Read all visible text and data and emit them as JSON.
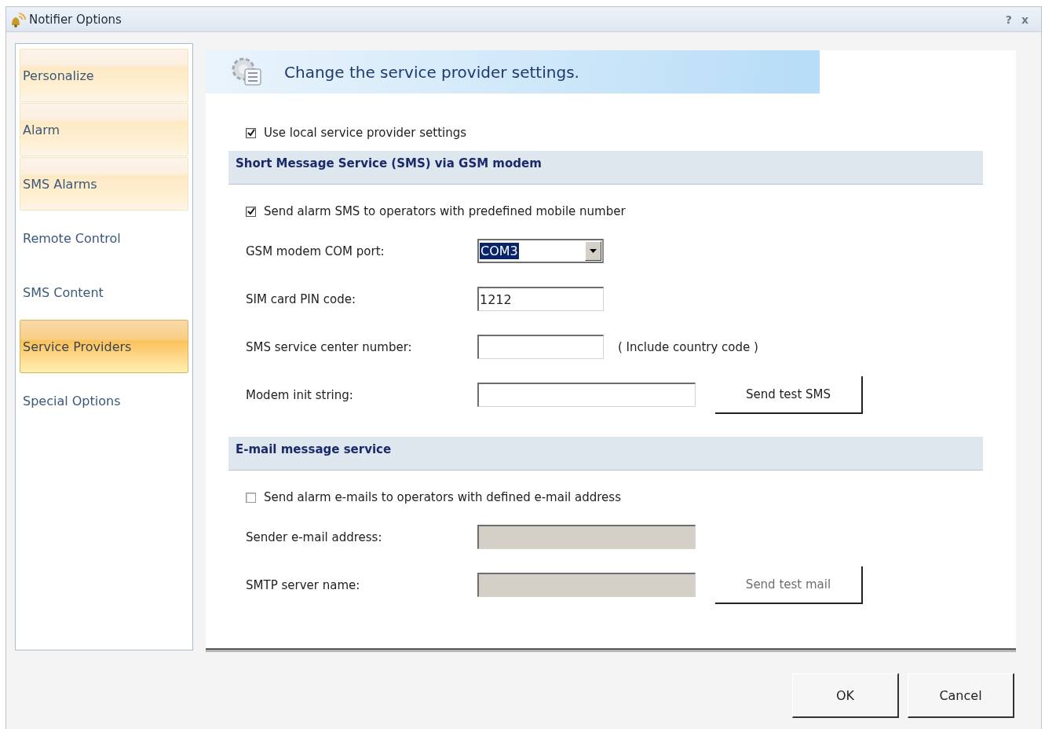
{
  "window": {
    "title": "Notifier Options",
    "controls": [
      "?",
      "x"
    ]
  },
  "sidebar": {
    "items": [
      {
        "label": "Personalize",
        "selected": false,
        "highlighted": true
      },
      {
        "label": "Alarm",
        "selected": false,
        "highlighted": true
      },
      {
        "label": "SMS Alarms",
        "selected": false,
        "highlighted": true
      },
      {
        "label": "Remote Control",
        "selected": false,
        "highlighted": false
      },
      {
        "label": "SMS Content",
        "selected": false,
        "highlighted": false
      },
      {
        "label": "Service Providers",
        "selected": true,
        "highlighted": false
      },
      {
        "label": "Special Options",
        "selected": false,
        "highlighted": false
      }
    ]
  },
  "header": {
    "title": "Change the service provider settings."
  },
  "use_local": {
    "label": "Use local service provider settings",
    "checked": true
  },
  "sections": [
    {
      "title": "Short Message Service (SMS) via GSM modem",
      "enable": {
        "label": "Send alarm SMS to operators with predefined mobile number",
        "checked": true
      },
      "rows": [
        {
          "label": "GSM modem COM port:",
          "kind": "dropdown",
          "value": "COM3",
          "disabled": false
        },
        {
          "label": "SIM card PIN code:",
          "kind": "text",
          "value": "1212",
          "disabled": false
        },
        {
          "label": "SMS service center number:",
          "kind": "text",
          "disabled": false,
          "note": "( Include country code )"
        },
        {
          "label": "Modem init string:",
          "kind": "text",
          "disabled": false,
          "wide": true,
          "button": {
            "label": "Send test SMS",
            "disabled": false
          }
        }
      ]
    },
    {
      "title": "E-mail message service",
      "enable": {
        "label": "Send alarm e-mails to operators with defined e-mail address",
        "checked": false
      },
      "rows": [
        {
          "label": "Sender e-mail address:",
          "kind": "text",
          "disabled": true,
          "wide": true
        },
        {
          "label": "SMTP server name:",
          "kind": "text",
          "disabled": true,
          "wide": true,
          "button": {
            "label": "Send test mail",
            "disabled": true
          }
        }
      ]
    }
  ],
  "buttons": [
    "OK",
    "Cancel"
  ]
}
